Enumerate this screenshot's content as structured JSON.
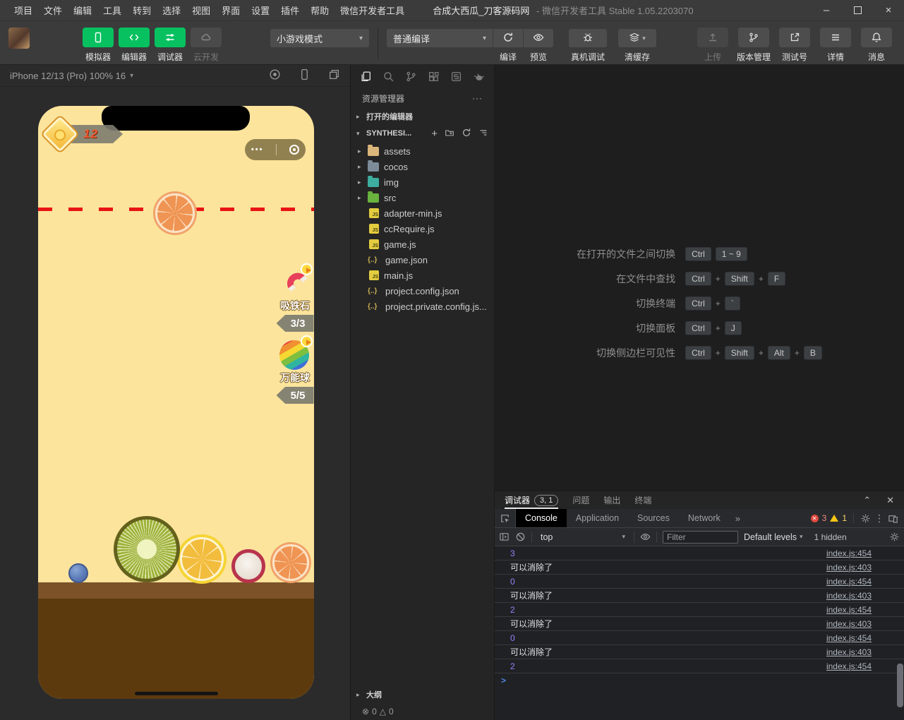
{
  "colors": {
    "wechat_green": "#07c160",
    "phone_bg": "#fce49c",
    "dashed_line_red": "#e81414",
    "console_number_purple": "#9980ff",
    "error_red": "#f28b82",
    "warning_yellow": "#fdd663"
  },
  "titlebar": {
    "menus": [
      "项目",
      "文件",
      "编辑",
      "工具",
      "转到",
      "选择",
      "视图",
      "界面",
      "设置",
      "插件",
      "帮助",
      "微信开发者工具"
    ],
    "project_title": "合成大西瓜_刀客源码网",
    "app_subtitle": "- 微信开发者工具 Stable 1.05.2203070",
    "window_controls": {
      "minimize": "–",
      "close": "×"
    }
  },
  "toolbar": {
    "left_buttons": [
      {
        "label": "模拟器",
        "icon": "phone",
        "state": "normal"
      },
      {
        "label": "编辑器",
        "icon": "code",
        "state": "normal"
      },
      {
        "label": "调试器",
        "icon": "sliders",
        "state": "normal"
      },
      {
        "label": "云开发",
        "icon": "cloud",
        "state": "disabled"
      }
    ],
    "mode_dropdown": "小游戏模式",
    "compile_dropdown": "普通编译",
    "compile_actions": [
      {
        "label": "编译",
        "icon": "refresh"
      },
      {
        "label": "预览",
        "icon": "eye"
      }
    ],
    "device_debug": {
      "label": "真机调试"
    },
    "clear_cache": {
      "label": "清缓存"
    },
    "right_buttons": [
      {
        "label": "上传",
        "icon": "upload",
        "state": "disabled"
      },
      {
        "label": "版本管理",
        "icon": "branch",
        "state": "normal"
      },
      {
        "label": "测试号",
        "icon": "external",
        "state": "normal"
      },
      {
        "label": "详情",
        "icon": "menu",
        "state": "normal"
      },
      {
        "label": "消息",
        "icon": "bell",
        "state": "normal"
      }
    ]
  },
  "simulator": {
    "device_label": "iPhone 12/13 (Pro) 100% 16",
    "game": {
      "score": "12",
      "capsule_dots": "•••",
      "items": [
        {
          "name": "吸铁石",
          "count": "3/3"
        },
        {
          "name": "万能球",
          "count": "5/5"
        }
      ]
    }
  },
  "explorer": {
    "title": "资源管理器",
    "more": "···",
    "open_editors_label": "打开的编辑器",
    "project_name": "SYNTHESI...",
    "files": [
      {
        "name": "assets",
        "icon": "folder-yellow",
        "folder": true
      },
      {
        "name": "cocos",
        "icon": "folder-gray",
        "folder": true
      },
      {
        "name": "img",
        "icon": "folder-teal",
        "folder": true
      },
      {
        "name": "src",
        "icon": "folder-green",
        "folder": true
      },
      {
        "name": "adapter-min.js",
        "icon": "js",
        "folder": false
      },
      {
        "name": "ccRequire.js",
        "icon": "js",
        "folder": false
      },
      {
        "name": "game.js",
        "icon": "js",
        "folder": false
      },
      {
        "name": "game.json",
        "icon": "json",
        "folder": false
      },
      {
        "name": "main.js",
        "icon": "js",
        "folder": false
      },
      {
        "name": "project.config.json",
        "icon": "json",
        "folder": false
      },
      {
        "name": "project.private.config.js...",
        "icon": "json",
        "folder": false
      }
    ],
    "outline_label": "大纲",
    "status": {
      "errors": "0",
      "warnings": "0"
    }
  },
  "editor": {
    "shortcuts": [
      {
        "label": "在打开的文件之间切换",
        "keys": [
          "Ctrl",
          "1 ~ 9"
        ]
      },
      {
        "label": "在文件中查找",
        "keys": [
          "Ctrl",
          "+",
          "Shift",
          "+",
          "F"
        ]
      },
      {
        "label": "切换终端",
        "keys": [
          "Ctrl",
          "+",
          "`"
        ]
      },
      {
        "label": "切换面板",
        "keys": [
          "Ctrl",
          "+",
          "J"
        ]
      },
      {
        "label": "切换侧边栏可见性",
        "keys": [
          "Ctrl",
          "+",
          "Shift",
          "+",
          "Alt",
          "+",
          "B"
        ]
      }
    ]
  },
  "debug": {
    "panel_tabs": [
      {
        "label": "调试器",
        "badge": "3, 1",
        "active": true
      },
      {
        "label": "问题"
      },
      {
        "label": "输出"
      },
      {
        "label": "终端"
      }
    ],
    "devtools_tabs": [
      "Console",
      "Application",
      "Sources",
      "Network"
    ],
    "more_tabs": "»",
    "error_count": "3",
    "warning_count": "1",
    "console_toolbar": {
      "context": "top",
      "filter_placeholder": "Filter",
      "levels": "Default levels",
      "hidden_count": "1 hidden"
    },
    "console_rows": [
      {
        "text": "3",
        "kind": "num",
        "link": "index.js:454"
      },
      {
        "text": "可以消除了",
        "kind": "str",
        "link": "index.js:403"
      },
      {
        "text": "0",
        "kind": "num",
        "link": "index.js:454"
      },
      {
        "text": "可以消除了",
        "kind": "str",
        "link": "index.js:403"
      },
      {
        "text": "2",
        "kind": "num",
        "link": "index.js:454"
      },
      {
        "text": "可以消除了",
        "kind": "str",
        "link": "index.js:403"
      },
      {
        "text": "0",
        "kind": "num",
        "link": "index.js:454"
      },
      {
        "text": "可以消除了",
        "kind": "str",
        "link": "index.js:403"
      },
      {
        "text": "2",
        "kind": "num",
        "link": "index.js:454"
      }
    ],
    "prompt": ">"
  }
}
